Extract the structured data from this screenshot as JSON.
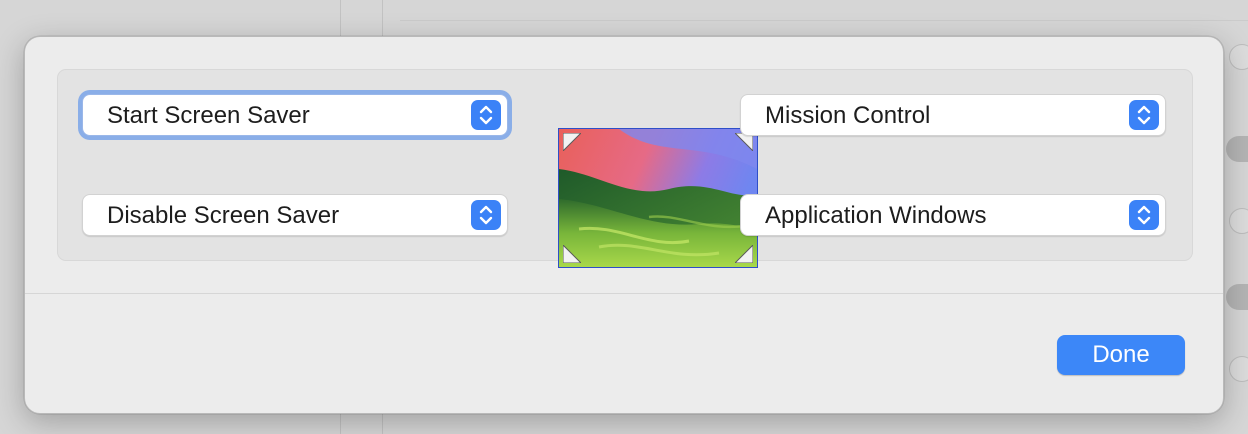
{
  "hot_corners": {
    "top_left": {
      "value": "Start Screen Saver"
    },
    "bottom_left": {
      "value": "Disable Screen Saver"
    },
    "top_right": {
      "value": "Mission Control"
    },
    "bottom_right": {
      "value": "Application Windows"
    }
  },
  "actions": {
    "done_label": "Done"
  },
  "colors": {
    "accent": "#3b82f7",
    "focus_ring": "#8aaee8",
    "sheet_background": "#ececec"
  },
  "icons": {
    "popup_arrows": "up-down-chevrons-icon",
    "corner_marker": "corner-triangle-icon"
  }
}
